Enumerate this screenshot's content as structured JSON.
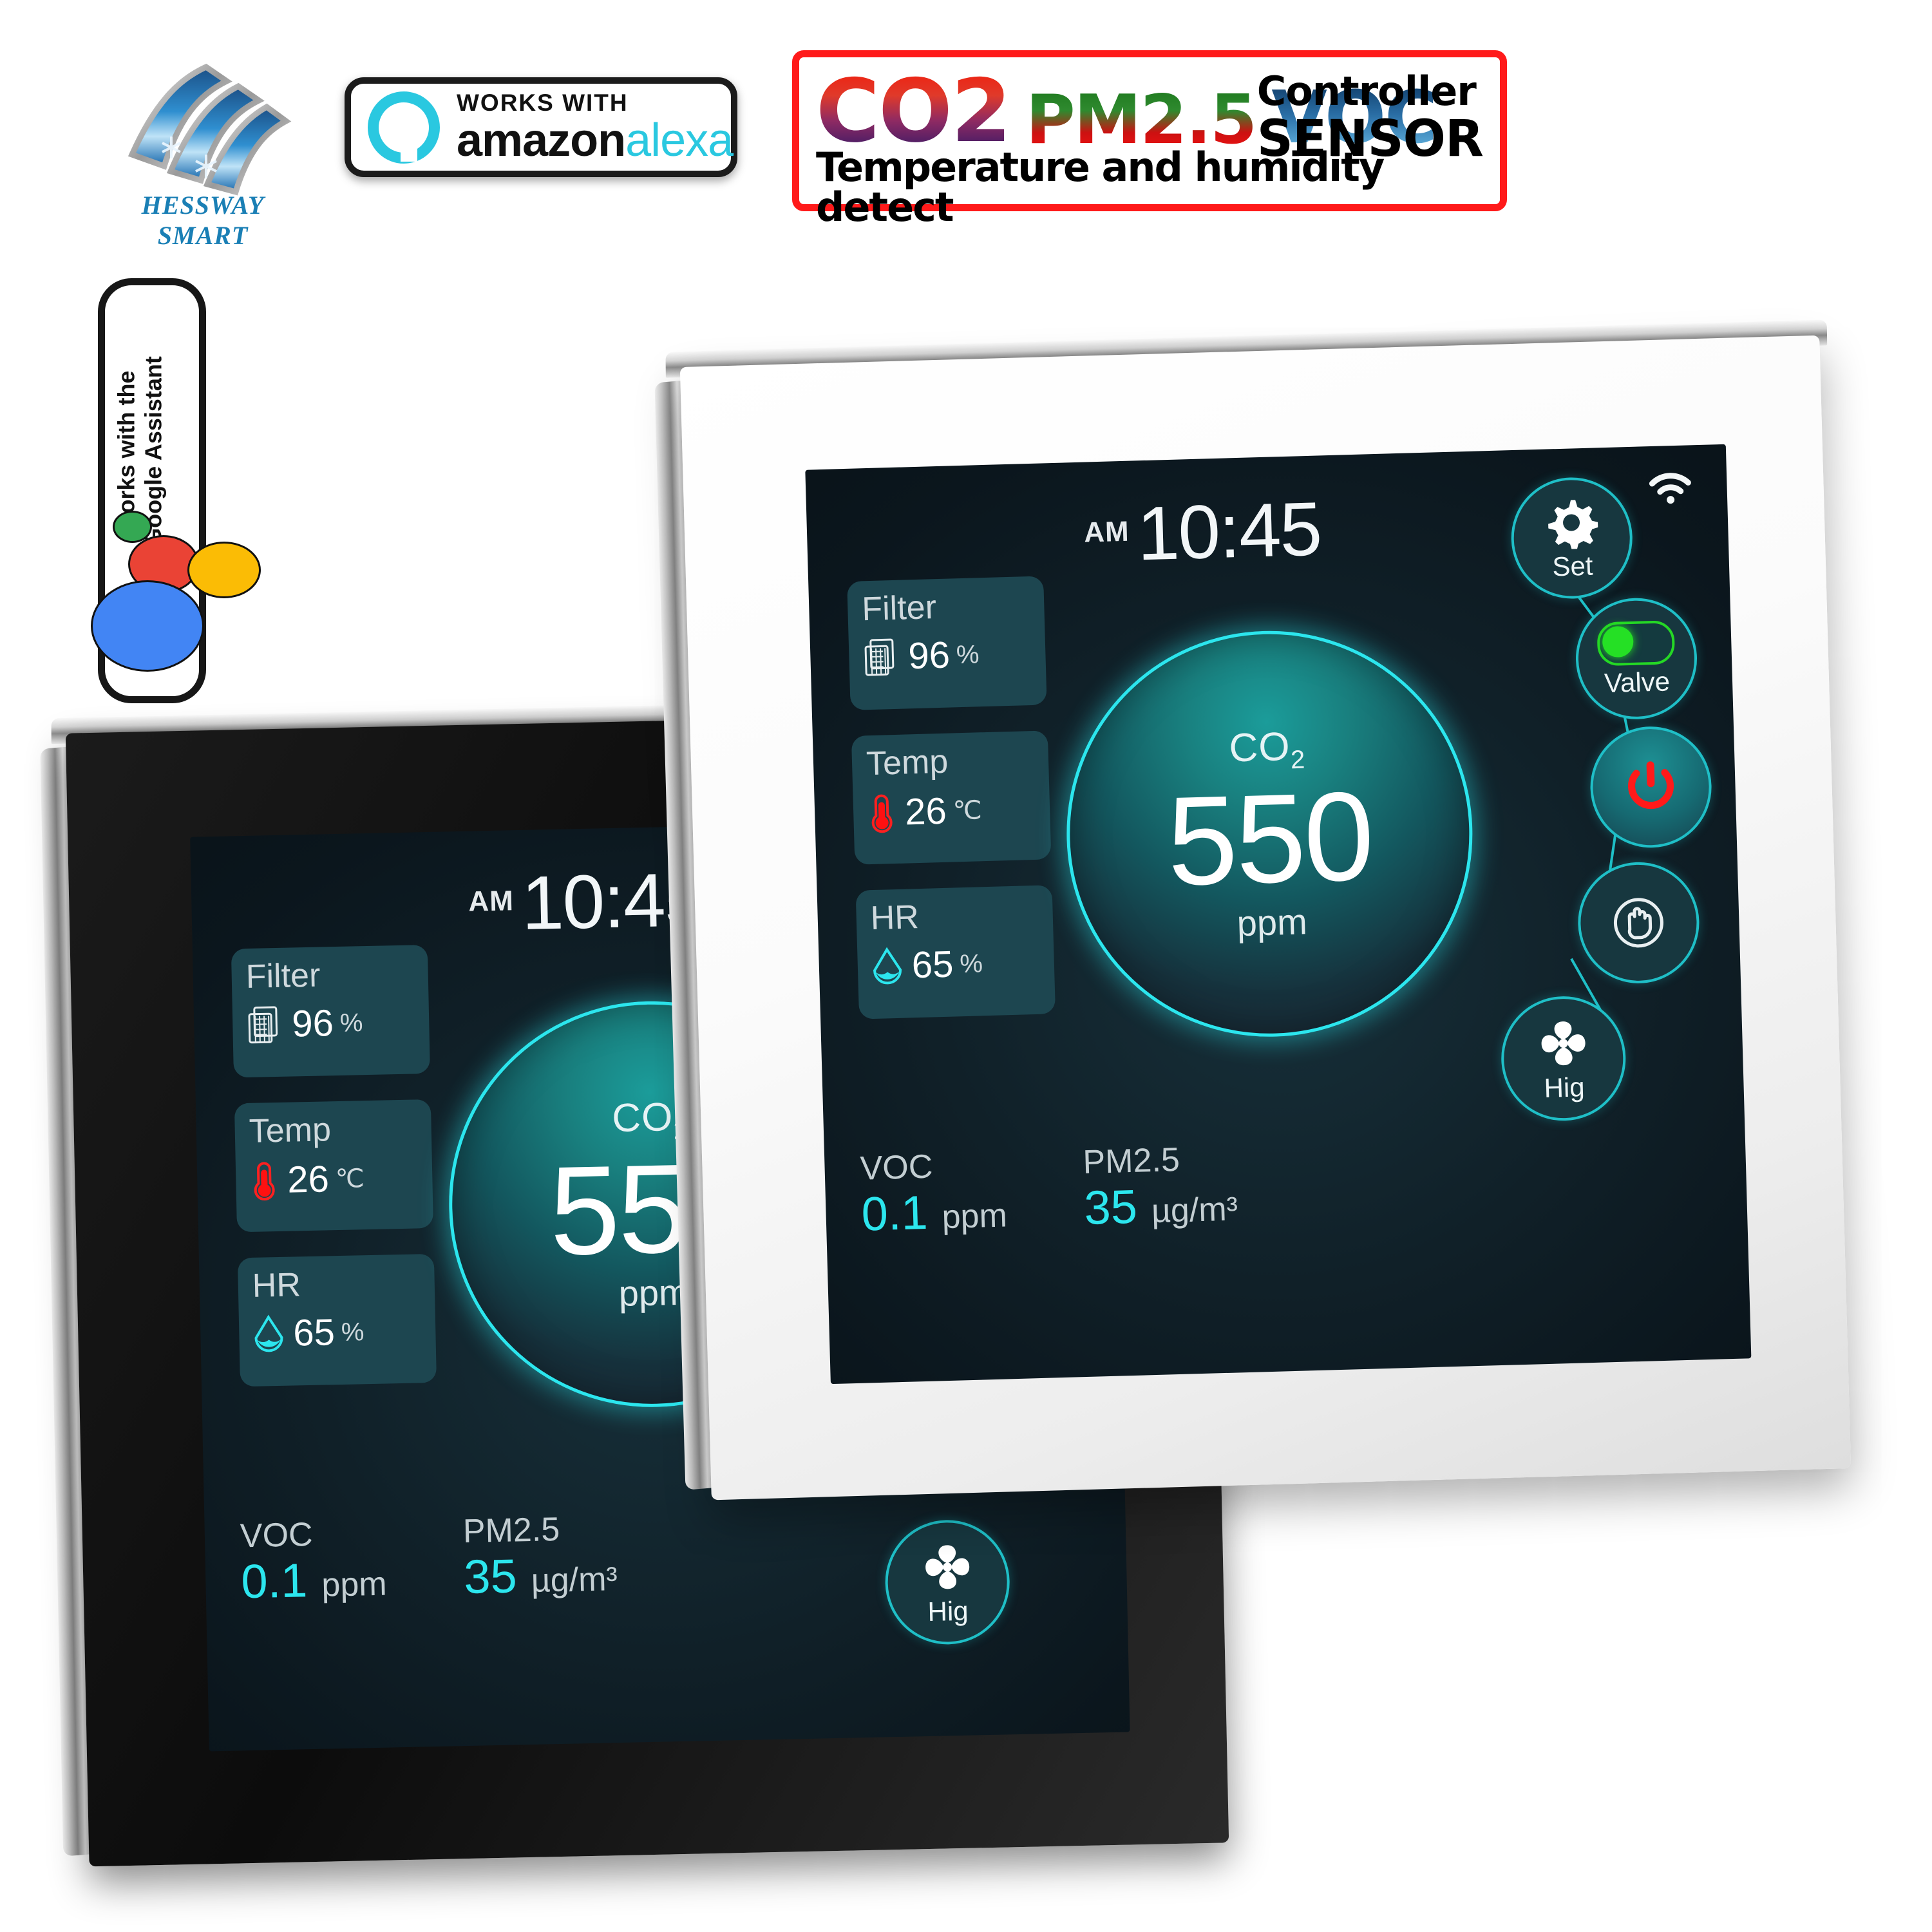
{
  "brand": {
    "logo_name": "HESSWAY SMART",
    "logo_icon": "snowflake-wave-logo"
  },
  "alexa_badge": {
    "works_with": "WORKS WITH",
    "brand_amazon": "amazon",
    "brand_alexa": "alexa",
    "icon": "alexa-ring-icon"
  },
  "google_badge": {
    "line1": "works with the",
    "line2": "Google Assistant",
    "dot_colors": [
      "#34a853",
      "#ea4335",
      "#fbbc05",
      "#4285f4"
    ]
  },
  "banner": {
    "co2": "CO2",
    "pm25": "PM2.5",
    "voc": "VOC",
    "controller": "Controller",
    "sensor": "SENSOR",
    "subtitle": "Temperature and humidity detect",
    "border_color": "#ff1a1a"
  },
  "device": {
    "status": {
      "wifi_icon": "wifi-icon"
    },
    "clock": {
      "ampm": "AM",
      "time": "10:45"
    },
    "tiles": [
      {
        "label": "Filter",
        "icon": "filter-grid-icon",
        "value": "96",
        "unit": "%"
      },
      {
        "label": "Temp",
        "icon": "thermometer-icon",
        "value": "26",
        "unit": "℃"
      },
      {
        "label": "HR",
        "icon": "humidity-drop-icon",
        "value": "65",
        "unit": "%"
      }
    ],
    "gauge": {
      "label": "CO",
      "label_sub": "2",
      "value": "550",
      "unit": "ppm",
      "ring_color": "#2ce6ee"
    },
    "controls": [
      {
        "name": "set",
        "icon": "gear-icon",
        "label": "Set"
      },
      {
        "name": "valve",
        "icon": "toggle-icon",
        "label": "Valve",
        "state_color": "#25e025"
      },
      {
        "name": "power",
        "icon": "power-icon",
        "label": "",
        "icon_color": "#ff1a1a"
      },
      {
        "name": "manual",
        "icon": "hand-icon",
        "label": ""
      },
      {
        "name": "fan",
        "icon": "fan-icon",
        "label": "Hig"
      }
    ],
    "readouts": [
      {
        "label": "VOC",
        "value": "0.1",
        "unit": "ppm"
      },
      {
        "label": "PM2.5",
        "value": "35",
        "unit": "µg/m³"
      }
    ],
    "accent_color": "#2ce6ee",
    "tile_bg": "#1d4650"
  }
}
